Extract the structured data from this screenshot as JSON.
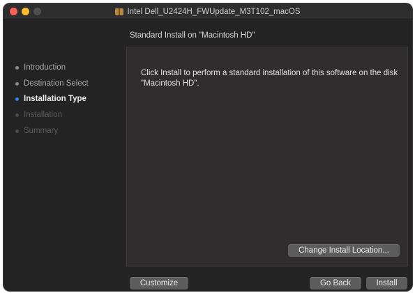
{
  "window": {
    "title": "Intel Dell_U2424H_FWUpdate_M3T102_macOS",
    "title_icon": "package-icon"
  },
  "sidebar": {
    "steps": [
      {
        "label": "Introduction",
        "state": "done"
      },
      {
        "label": "Destination Select",
        "state": "done"
      },
      {
        "label": "Installation Type",
        "state": "current"
      },
      {
        "label": "Installation",
        "state": "pending"
      },
      {
        "label": "Summary",
        "state": "pending"
      }
    ]
  },
  "main": {
    "section_title": "Standard Install on \"Macintosh HD\"",
    "body_text": "Click Install to perform a standard installation of this software on the disk \"Macintosh HD\".",
    "change_location_label": "Change Install Location..."
  },
  "footer": {
    "customize_label": "Customize",
    "go_back_label": "Go Back",
    "install_label": "Install"
  },
  "colors": {
    "current_step_dot": "#2f7ff6",
    "close": "#ff5f57",
    "minimize": "#febc2e",
    "window_bg": "#242323",
    "button_bg": "#5c5c5c"
  }
}
